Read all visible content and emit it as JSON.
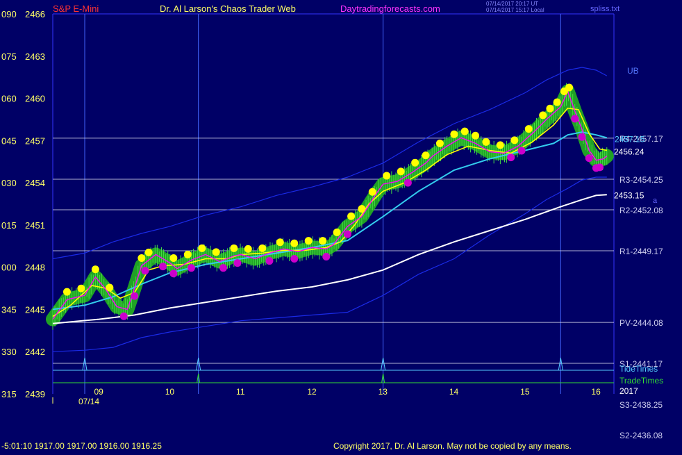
{
  "header": {
    "symbol": "S&P E-Mini",
    "title": "Dr. Al Larson's Chaos Trader Web",
    "site": "Daytradingforecasts.com",
    "stamp_utc": "07/14/2017 20:17 UT",
    "stamp_local": "07/14/2017 15:17 Local",
    "file": "spliss.txt"
  },
  "footer": {
    "status": "-5:01:10  1917.00 1917.00 1916.00 1916.25",
    "copyright": "Copyright 2017, Dr. Al Larson. May not be copied by any means."
  },
  "colors": {
    "background": "#000066",
    "frame": "#3333ff",
    "band": "#1a2ae6",
    "price": "#ff00ff",
    "avg_fast": "#ffff00",
    "avg_mid": "#33ccee",
    "avg_slow": "#ffffff",
    "glow": "#22aa22",
    "bull_dot": "#ffff00",
    "bear_dot": "#cc00cc",
    "level_lines": "#ddddee",
    "tide": "#55ccff",
    "trade": "#33dd33"
  },
  "chart_data": {
    "type": "line",
    "x_unit": "hour of day",
    "x_range": [
      8.35,
      16.25
    ],
    "x_ticks": [
      {
        "x": 9,
        "label": "09"
      },
      {
        "x": 10,
        "label": "10"
      },
      {
        "x": 11,
        "label": "11"
      },
      {
        "x": 12,
        "label": "12"
      },
      {
        "x": 13,
        "label": "13"
      },
      {
        "x": 14,
        "label": "14"
      },
      {
        "x": 15,
        "label": "15"
      },
      {
        "x": 16,
        "label": "16"
      }
    ],
    "date_label": "07/14",
    "ylim": [
      2439,
      2466
    ],
    "y_ticks": [
      {
        "y": 2466,
        "left": "090",
        "right": "2466"
      },
      {
        "y": 2463,
        "left": "075",
        "right": "2463"
      },
      {
        "y": 2460,
        "left": "060",
        "right": "2460"
      },
      {
        "y": 2457,
        "left": "045",
        "right": "2457"
      },
      {
        "y": 2454,
        "left": "030",
        "right": "2454"
      },
      {
        "y": 2451,
        "left": "015",
        "right": "2451"
      },
      {
        "y": 2448,
        "left": "000",
        "right": "2448"
      },
      {
        "y": 2445,
        "left": "345",
        "right": "2445"
      },
      {
        "y": 2442,
        "left": "330",
        "right": "2442"
      },
      {
        "y": 2439,
        "left": "315",
        "right": "2439"
      }
    ],
    "levels": [
      {
        "name": "R3",
        "value": 2454.25,
        "label": "R3-2454.25",
        "line": true
      },
      {
        "name": "R2",
        "value": 2452.08,
        "label": "R2-2452.08",
        "line": true
      },
      {
        "name": "R1",
        "value": 2449.17,
        "label": "R1-2449.17",
        "line": true
      },
      {
        "name": "PV",
        "value": 2444.08,
        "label": "PV-2444.08",
        "line": true
      },
      {
        "name": "S1",
        "value": 2441.17,
        "label": "S1-2441.17",
        "line": true
      },
      {
        "name": "R4",
        "value": 2457.17,
        "label": "R4-2457.17",
        "line": true
      },
      {
        "name": "S3",
        "value": 2438.25,
        "label": "S3-2438.25",
        "line": false
      },
      {
        "name": "S2",
        "value": 2436.08,
        "label": "S2-2436.08",
        "line": false
      }
    ],
    "series": [
      {
        "id": "price",
        "x": [
          8.35,
          8.55,
          8.8,
          8.95,
          9.1,
          9.25,
          9.4,
          9.5,
          9.6,
          9.8,
          10.0,
          10.1,
          10.3,
          10.5,
          10.7,
          10.9,
          11.0,
          11.2,
          11.4,
          11.6,
          11.8,
          12.0,
          12.2,
          12.3,
          12.5,
          12.7,
          12.9,
          13.0,
          13.2,
          13.4,
          13.6,
          13.7,
          13.9,
          14.1,
          14.3,
          14.5,
          14.7,
          14.9,
          15.1,
          15.3,
          15.5,
          15.6,
          15.7,
          15.8,
          15.9,
          16.0,
          16.1,
          16.15
        ],
        "values": [
          2444.3,
          2445.7,
          2446.0,
          2447.3,
          2446.4,
          2445.2,
          2445.0,
          2446.5,
          2448.1,
          2448.9,
          2448.3,
          2447.9,
          2448.5,
          2448.9,
          2448.4,
          2448.8,
          2448.9,
          2448.6,
          2449.0,
          2449.3,
          2449.1,
          2449.4,
          2449.3,
          2449.6,
          2450.9,
          2451.6,
          2453.2,
          2453.9,
          2454.1,
          2454.7,
          2455.4,
          2455.9,
          2456.6,
          2457.2,
          2456.8,
          2456.2,
          2456.1,
          2456.6,
          2457.5,
          2458.5,
          2459.4,
          2460.5,
          2459.1,
          2457.8,
          2456.3,
          2455.6,
          2455.7,
          2455.9
        ]
      },
      {
        "id": "avg_fast",
        "x": [
          8.35,
          8.6,
          8.9,
          9.1,
          9.3,
          9.5,
          9.7,
          9.9,
          10.2,
          10.5,
          10.8,
          11.0,
          11.3,
          11.6,
          11.9,
          12.2,
          12.4,
          12.6,
          12.8,
          13.0,
          13.3,
          13.6,
          13.9,
          14.2,
          14.5,
          14.8,
          15.1,
          15.4,
          15.6,
          15.75,
          15.9,
          16.05,
          16.15
        ],
        "values": [
          2444.5,
          2445.3,
          2446.7,
          2446.5,
          2445.8,
          2446.2,
          2447.8,
          2448.1,
          2448.2,
          2448.6,
          2448.6,
          2448.9,
          2449.0,
          2449.2,
          2449.2,
          2449.4,
          2449.8,
          2451.0,
          2452.5,
          2453.4,
          2454.0,
          2454.9,
          2456.0,
          2456.6,
          2456.3,
          2456.1,
          2456.9,
          2458.1,
          2459.3,
          2459.2,
          2457.5,
          2456.4,
          2456.3
        ]
      },
      {
        "id": "avg_mid",
        "x": [
          8.35,
          8.8,
          9.2,
          9.6,
          10.0,
          10.5,
          11.0,
          11.5,
          12.0,
          12.5,
          13.0,
          13.5,
          14.0,
          14.5,
          15.0,
          15.4,
          15.6,
          15.8,
          16.0,
          16.15
        ],
        "values": [
          2445.0,
          2445.3,
          2445.9,
          2446.8,
          2447.6,
          2448.2,
          2448.6,
          2449.0,
          2449.4,
          2449.9,
          2451.6,
          2453.4,
          2454.9,
          2455.7,
          2456.3,
          2456.8,
          2457.4,
          2457.6,
          2457.4,
          2457.2
        ]
      },
      {
        "id": "avg_slow",
        "x": [
          8.35,
          9.0,
          9.5,
          10.0,
          10.5,
          11.0,
          11.5,
          12.0,
          12.5,
          13.0,
          13.5,
          14.0,
          14.5,
          15.0,
          15.5,
          15.8,
          16.0,
          16.15
        ],
        "values": [
          2444.0,
          2444.3,
          2444.6,
          2445.1,
          2445.5,
          2445.9,
          2446.3,
          2446.6,
          2447.1,
          2447.8,
          2448.9,
          2449.8,
          2450.6,
          2451.4,
          2452.3,
          2452.8,
          2453.1,
          2453.15
        ]
      },
      {
        "id": "upper_band",
        "x": [
          8.35,
          8.8,
          9.2,
          9.6,
          10.0,
          10.5,
          11.0,
          11.5,
          12.0,
          12.5,
          13.0,
          13.5,
          14.0,
          14.5,
          15.0,
          15.3,
          15.6,
          15.8,
          16.0,
          16.15
        ],
        "values": [
          2448.6,
          2449.0,
          2449.8,
          2450.4,
          2450.9,
          2451.7,
          2452.3,
          2453.1,
          2453.7,
          2454.4,
          2455.4,
          2456.9,
          2458.2,
          2459.2,
          2460.4,
          2461.3,
          2462.0,
          2462.2,
          2462.0,
          2461.6
        ]
      },
      {
        "id": "lower_band",
        "x": [
          8.35,
          8.8,
          9.2,
          9.6,
          10.0,
          10.5,
          11.0,
          11.5,
          12.0,
          12.5,
          13.0,
          13.5,
          14.0,
          14.5,
          15.0,
          15.3,
          15.6,
          15.8,
          16.0,
          16.15
        ],
        "values": [
          2442.0,
          2442.1,
          2442.3,
          2443.0,
          2443.4,
          2443.8,
          2444.2,
          2444.4,
          2444.6,
          2444.8,
          2446.0,
          2447.5,
          2448.6,
          2450.3,
          2451.8,
          2452.8,
          2453.6,
          2454.2,
          2454.4,
          2454.4
        ]
      }
    ],
    "bull_dots_x": [
      8.55,
      8.75,
      8.95,
      9.15,
      9.6,
      9.7,
      10.05,
      10.25,
      10.45,
      10.65,
      10.9,
      11.1,
      11.3,
      11.55,
      11.75,
      11.95,
      12.15,
      12.35,
      12.55,
      12.7,
      12.85,
      13.05,
      13.25,
      13.45,
      13.6,
      13.8,
      14.0,
      14.15,
      14.3,
      14.45,
      14.65,
      14.85,
      15.05,
      15.25,
      15.35,
      15.45,
      15.55,
      15.62
    ],
    "bear_dots_x": [
      9.35,
      9.5,
      9.65,
      9.9,
      10.05,
      10.3,
      10.75,
      10.95,
      11.4,
      11.75,
      12.2,
      12.5,
      13.35,
      14.8,
      14.95,
      15.7,
      15.8,
      15.9,
      16.0,
      16.05
    ],
    "end_labels": [
      {
        "text": "UB",
        "y": 2462.0
      },
      {
        "text": "2453.15",
        "y": 2453.15
      },
      {
        "text": "2456.24",
        "y": 2456.24
      },
      {
        "text": "2457.15",
        "y": 2457.15
      }
    ],
    "tide_label": "TideTimes",
    "tide_times": [
      8.8,
      10.4,
      13.0,
      15.5
    ],
    "trade_label": "TradeTimes",
    "trade_times": [
      10.4,
      13.0
    ],
    "year_label": "2017",
    "extra_marks": [
      "a"
    ]
  }
}
